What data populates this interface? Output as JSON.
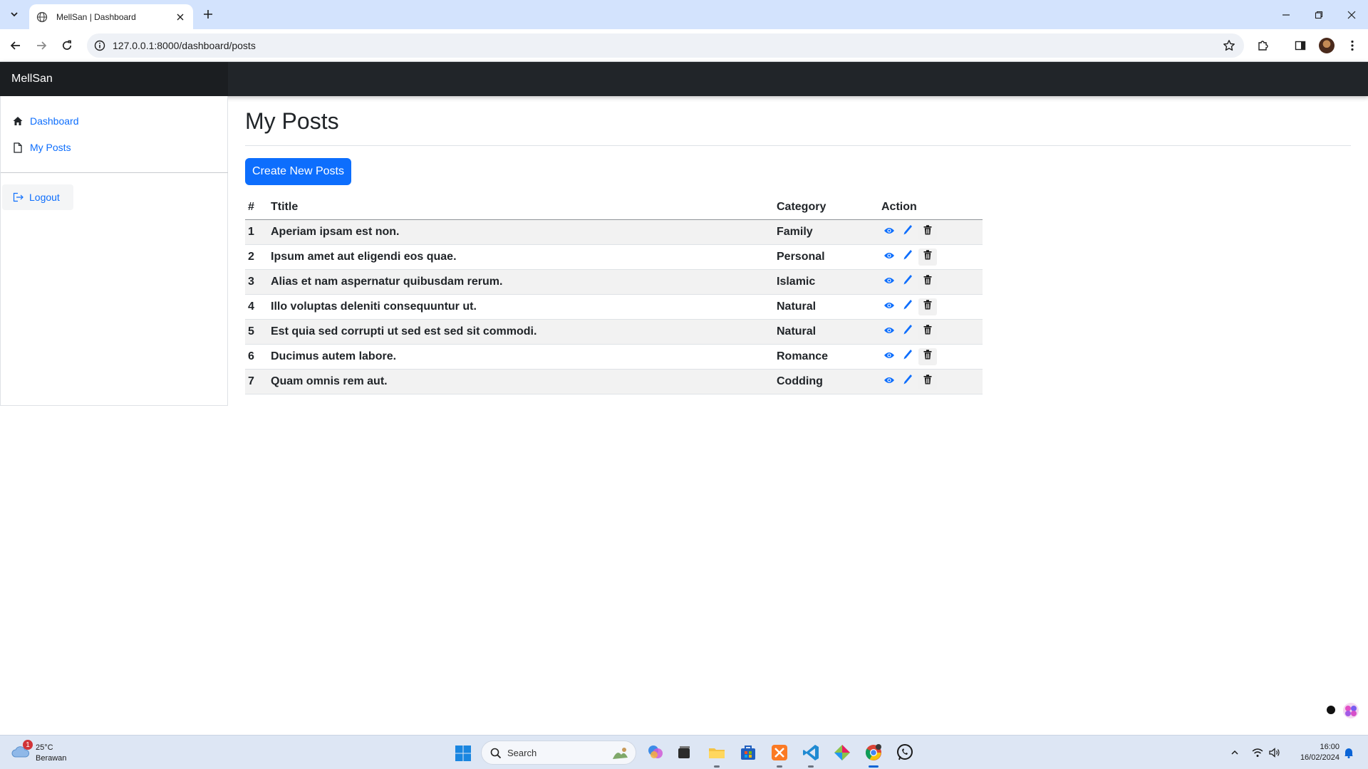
{
  "browser": {
    "tab_title": "MellSan | Dashboard",
    "url": "127.0.0.1:8000/dashboard/posts"
  },
  "app": {
    "brand": "MellSan"
  },
  "sidebar": {
    "items": [
      {
        "label": "Dashboard",
        "icon": "house-icon"
      },
      {
        "label": "My Posts",
        "icon": "file-icon"
      }
    ],
    "logout_label": "Logout"
  },
  "main": {
    "title": "My Posts",
    "create_button": "Create New Posts",
    "table": {
      "headers": [
        "#",
        "Ttitle",
        "Category",
        "Action"
      ],
      "rows": [
        {
          "num": "1",
          "title": "Aperiam ipsam est non.",
          "category": "Family"
        },
        {
          "num": "2",
          "title": "Ipsum amet aut eligendi eos quae.",
          "category": "Personal"
        },
        {
          "num": "3",
          "title": "Alias et nam aspernatur quibusdam rerum.",
          "category": "Islamic"
        },
        {
          "num": "4",
          "title": "Illo voluptas deleniti consequuntur ut.",
          "category": "Natural"
        },
        {
          "num": "5",
          "title": "Est quia sed corrupti ut sed est sed sit commodi.",
          "category": "Natural"
        },
        {
          "num": "6",
          "title": "Ducimus autem labore.",
          "category": "Romance"
        },
        {
          "num": "7",
          "title": "Quam omnis rem aut.",
          "category": "Codding"
        }
      ]
    }
  },
  "taskbar": {
    "weather_temp": "25°C",
    "weather_cond": "Berawan",
    "weather_badge": "1",
    "search_label": "Search",
    "time": "16:00",
    "date": "16/02/2024"
  },
  "colors": {
    "primary": "#0d6efd",
    "navbar": "#212529",
    "tabbar": "#d3e3fd"
  }
}
